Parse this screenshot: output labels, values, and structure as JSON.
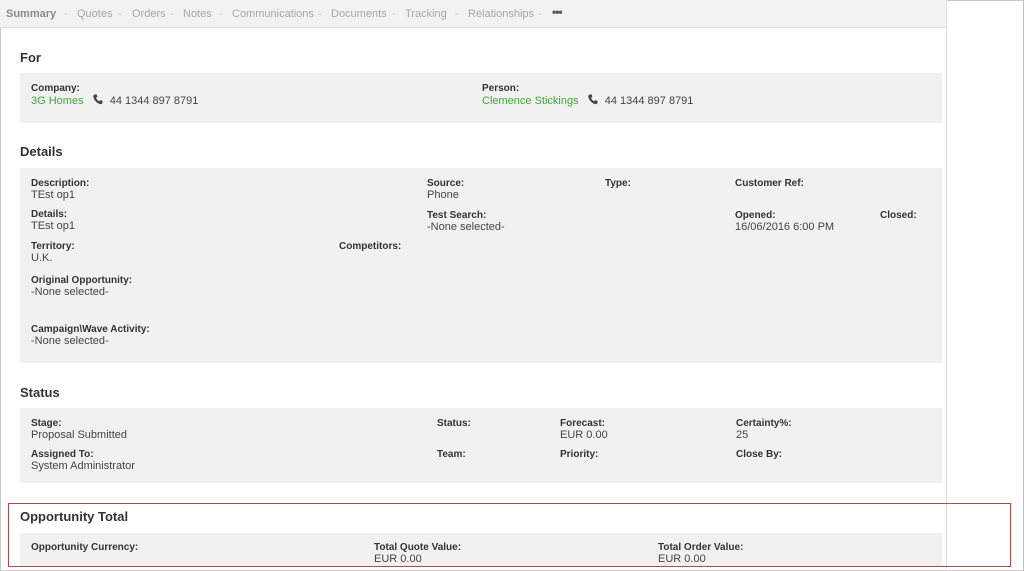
{
  "tabs": [
    {
      "label": "Summary",
      "active": true
    },
    {
      "label": "Quotes",
      "active": false
    },
    {
      "label": "Orders",
      "active": false
    },
    {
      "label": "Notes",
      "active": false
    },
    {
      "label": "Communications",
      "active": false
    },
    {
      "label": "Documents",
      "active": false
    },
    {
      "label": "Tracking",
      "active": false
    },
    {
      "label": "Relationships",
      "active": false
    }
  ],
  "more_label": "•••",
  "for": {
    "title": "For",
    "company_label": "Company:",
    "company_name": "3G Homes",
    "company_phone": "44 1344 897 8791",
    "person_label": "Person:",
    "person_name": "Clemence Stickings",
    "person_phone": "44 1344 897 8791"
  },
  "details": {
    "title": "Details",
    "description_label": "Description:",
    "description_value": "TEst op1",
    "source_label": "Source:",
    "source_value": "Phone",
    "type_label": "Type:",
    "customer_ref_label": "Customer Ref:",
    "details_label": "Details:",
    "details_value": "TEst op1",
    "test_search_label": "Test Search:",
    "test_search_value": "-None selected-",
    "opened_label": "Opened:",
    "opened_value": "16/06/2016 6:00 PM",
    "closed_label": "Closed:",
    "territory_label": "Territory:",
    "territory_value": "U.K.",
    "competitors_label": "Competitors:",
    "original_opportunity_label": "Original Opportunity:",
    "original_opportunity_value": "-None selected-",
    "campaign_label": "Campaign\\Wave Activity:",
    "campaign_value": "-None selected-"
  },
  "status": {
    "title": "Status",
    "stage_label": "Stage:",
    "stage_value": "Proposal Submitted",
    "status_label": "Status:",
    "forecast_label": "Forecast:",
    "forecast_value": "EUR 0.00",
    "certainty_label": "Certainty%:",
    "certainty_value": "25",
    "assigned_label": "Assigned To:",
    "assigned_value": "System Administrator",
    "team_label": "Team:",
    "priority_label": "Priority:",
    "close_by_label": "Close By:"
  },
  "total": {
    "title": "Opportunity Total",
    "currency_label": "Opportunity Currency:",
    "quote_label": "Total Quote Value:",
    "quote_value": "EUR 0.00",
    "order_label": "Total Order Value:",
    "order_value": "EUR 0.00"
  },
  "colors": {
    "link": "#44a63a",
    "highlight_border": "#b04a4a",
    "box_background": "#f1f1f1"
  }
}
